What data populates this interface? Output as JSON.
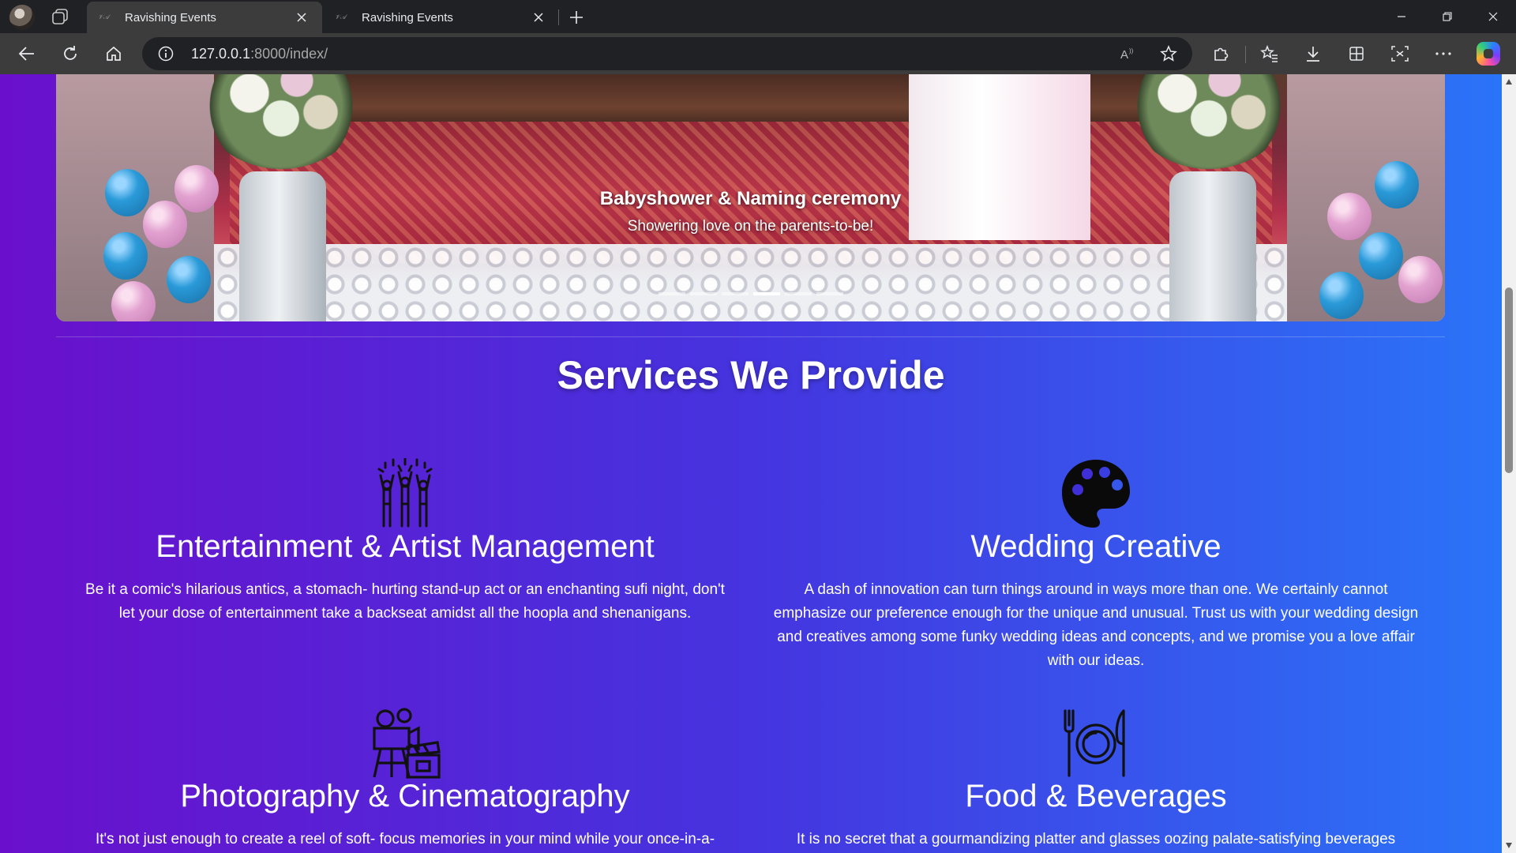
{
  "browser": {
    "tabs": [
      {
        "title": "Ravishing Events",
        "active": true
      },
      {
        "title": "Ravishing Events",
        "active": false
      }
    ],
    "address": {
      "host": "127.0.0.1",
      "rest": ":8000/index/"
    }
  },
  "carousel": {
    "caption_title": "Babyshower & Naming ceremony",
    "caption_subtitle": "Showering love on the parents-to-be!",
    "slide_count": 6,
    "active_index": 3
  },
  "services": {
    "heading": "Services We Provide",
    "items": [
      {
        "icon": "party-people-icon",
        "title": "Entertainment & Artist Management",
        "description": "Be it a comic's hilarious antics, a stomach- hurting stand-up act or an enchanting sufi night, don't let your dose of entertainment take a backseat amidst all the hoopla and shenanigans."
      },
      {
        "icon": "palette-icon",
        "title": "Wedding Creative",
        "description": "A dash of innovation can turn things around in ways more than one. We certainly cannot emphasize our preference enough for the unique and unusual. Trust us with your wedding design and creatives among some funky wedding ideas and concepts, and we promise you a love affair with our ideas."
      },
      {
        "icon": "film-camera-icon",
        "title": "Photography & Cinematography",
        "description": "It's not just enough to create a reel of soft- focus memories in your mind while your once-in-a-"
      },
      {
        "icon": "plate-cutlery-icon",
        "title": "Food & Beverages",
        "description": "It is no secret that a gourmandizing platter and glasses oozing palate-satisfying beverages"
      }
    ]
  }
}
